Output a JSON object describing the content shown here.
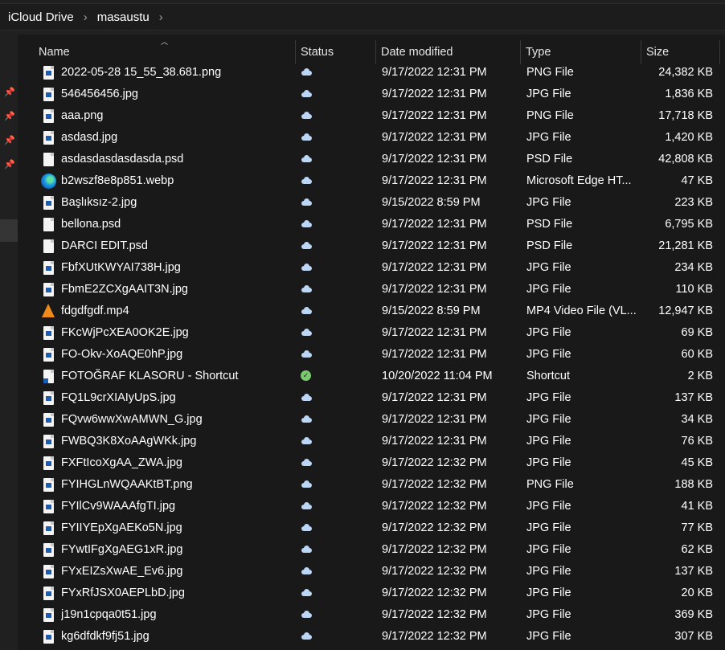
{
  "breadcrumb": [
    "iCloud Drive",
    "masaustu"
  ],
  "columns": {
    "name": "Name",
    "status": "Status",
    "date": "Date modified",
    "type": "Type",
    "size": "Size"
  },
  "files": [
    {
      "name": "2022-05-28 15_55_38.681.png",
      "icon": "image-file-icon",
      "status": "cloud",
      "date": "9/17/2022 12:31 PM",
      "type": "PNG File",
      "size": "24,382 KB"
    },
    {
      "name": "546456456.jpg",
      "icon": "image-file-icon",
      "status": "cloud",
      "date": "9/17/2022 12:31 PM",
      "type": "JPG File",
      "size": "1,836 KB"
    },
    {
      "name": "aaa.png",
      "icon": "image-file-icon",
      "status": "cloud",
      "date": "9/17/2022 12:31 PM",
      "type": "PNG File",
      "size": "17,718 KB"
    },
    {
      "name": "asdasd.jpg",
      "icon": "image-file-icon",
      "status": "cloud",
      "date": "9/17/2022 12:31 PM",
      "type": "JPG File",
      "size": "1,420 KB"
    },
    {
      "name": "asdasdasdasdasda.psd",
      "icon": "blank-file-icon",
      "status": "cloud",
      "date": "9/17/2022 12:31 PM",
      "type": "PSD File",
      "size": "42,808 KB"
    },
    {
      "name": "b2wszf8e8p851.webp",
      "icon": "edge-icon",
      "status": "cloud",
      "date": "9/17/2022 12:31 PM",
      "type": "Microsoft Edge HT...",
      "size": "47 KB"
    },
    {
      "name": "Başlıksız-2.jpg",
      "icon": "image-file-icon",
      "status": "cloud",
      "date": "9/15/2022 8:59 PM",
      "type": "JPG File",
      "size": "223 KB"
    },
    {
      "name": "bellona.psd",
      "icon": "blank-file-icon",
      "status": "cloud",
      "date": "9/17/2022 12:31 PM",
      "type": "PSD File",
      "size": "6,795 KB"
    },
    {
      "name": "DARCI EDIT.psd",
      "icon": "blank-file-icon",
      "status": "cloud",
      "date": "9/17/2022 12:31 PM",
      "type": "PSD File",
      "size": "21,281 KB"
    },
    {
      "name": "FbfXUtKWYAI738H.jpg",
      "icon": "image-file-icon",
      "status": "cloud",
      "date": "9/17/2022 12:31 PM",
      "type": "JPG File",
      "size": "234 KB"
    },
    {
      "name": "FbmE2ZCXgAAIT3N.jpg",
      "icon": "image-file-icon",
      "status": "cloud",
      "date": "9/17/2022 12:31 PM",
      "type": "JPG File",
      "size": "110 KB"
    },
    {
      "name": "fdgdfgdf.mp4",
      "icon": "vlc-icon",
      "status": "cloud",
      "date": "9/15/2022 8:59 PM",
      "type": "MP4 Video File (VL...",
      "size": "12,947 KB"
    },
    {
      "name": "FKcWjPcXEA0OK2E.jpg",
      "icon": "image-file-icon",
      "status": "cloud",
      "date": "9/17/2022 12:31 PM",
      "type": "JPG File",
      "size": "69 KB"
    },
    {
      "name": "FO-Okv-XoAQE0hP.jpg",
      "icon": "image-file-icon",
      "status": "cloud",
      "date": "9/17/2022 12:31 PM",
      "type": "JPG File",
      "size": "60 KB"
    },
    {
      "name": "FOTOĞRAF KLASORU - Shortcut",
      "icon": "shortcut-icon",
      "status": "synced",
      "date": "10/20/2022 11:04 PM",
      "type": "Shortcut",
      "size": "2 KB"
    },
    {
      "name": "FQ1L9crXIAIyUpS.jpg",
      "icon": "image-file-icon",
      "status": "cloud",
      "date": "9/17/2022 12:31 PM",
      "type": "JPG File",
      "size": "137 KB"
    },
    {
      "name": "FQvw6wwXwAMWN_G.jpg",
      "icon": "image-file-icon",
      "status": "cloud",
      "date": "9/17/2022 12:31 PM",
      "type": "JPG File",
      "size": "34 KB"
    },
    {
      "name": "FWBQ3K8XoAAgWKk.jpg",
      "icon": "image-file-icon",
      "status": "cloud",
      "date": "9/17/2022 12:31 PM",
      "type": "JPG File",
      "size": "76 KB"
    },
    {
      "name": "FXFtIcoXgAA_ZWA.jpg",
      "icon": "image-file-icon",
      "status": "cloud",
      "date": "9/17/2022 12:32 PM",
      "type": "JPG File",
      "size": "45 KB"
    },
    {
      "name": "FYIHGLnWQAAKtBT.png",
      "icon": "image-file-icon",
      "status": "cloud",
      "date": "9/17/2022 12:32 PM",
      "type": "PNG File",
      "size": "188 KB"
    },
    {
      "name": "FYIlCv9WAAAfgTI.jpg",
      "icon": "image-file-icon",
      "status": "cloud",
      "date": "9/17/2022 12:32 PM",
      "type": "JPG File",
      "size": "41 KB"
    },
    {
      "name": "FYIIYEpXgAEKo5N.jpg",
      "icon": "image-file-icon",
      "status": "cloud",
      "date": "9/17/2022 12:32 PM",
      "type": "JPG File",
      "size": "77 KB"
    },
    {
      "name": "FYwtIFgXgAEG1xR.jpg",
      "icon": "image-file-icon",
      "status": "cloud",
      "date": "9/17/2022 12:32 PM",
      "type": "JPG File",
      "size": "62 KB"
    },
    {
      "name": "FYxEIZsXwAE_Ev6.jpg",
      "icon": "image-file-icon",
      "status": "cloud",
      "date": "9/17/2022 12:32 PM",
      "type": "JPG File",
      "size": "137 KB"
    },
    {
      "name": "FYxRfJSX0AEPLbD.jpg",
      "icon": "image-file-icon",
      "status": "cloud",
      "date": "9/17/2022 12:32 PM",
      "type": "JPG File",
      "size": "20 KB"
    },
    {
      "name": "j19n1cpqa0t51.jpg",
      "icon": "image-file-icon",
      "status": "cloud",
      "date": "9/17/2022 12:32 PM",
      "type": "JPG File",
      "size": "369 KB"
    },
    {
      "name": "kg6dfdkf9fj51.jpg",
      "icon": "image-file-icon",
      "status": "cloud",
      "date": "9/17/2022 12:32 PM",
      "type": "JPG File",
      "size": "307 KB"
    }
  ]
}
